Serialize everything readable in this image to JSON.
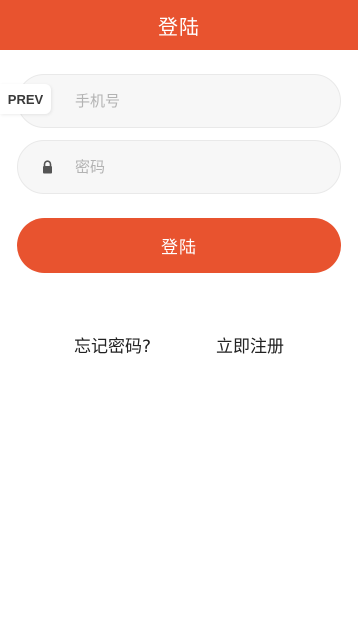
{
  "header": {
    "title": "登陆"
  },
  "prev_tab": {
    "label": "PREV"
  },
  "form": {
    "phone": {
      "placeholder": "手机号",
      "value": ""
    },
    "password": {
      "placeholder": "密码",
      "value": "",
      "icon": "lock-icon"
    },
    "submit_label": "登陆"
  },
  "links": {
    "forgot_password": "忘记密码?",
    "register": "立即注册"
  },
  "colors": {
    "accent": "#e8532f",
    "field_background": "#f7f7f7",
    "placeholder": "#b3b3b3"
  }
}
